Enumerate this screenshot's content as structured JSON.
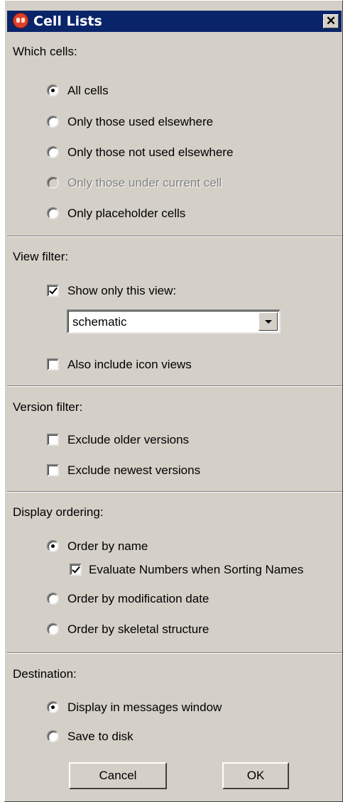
{
  "window": {
    "title": "Cell Lists"
  },
  "which_cells": {
    "label": "Which cells:",
    "options": [
      {
        "label": "All cells",
        "checked": true,
        "enabled": true
      },
      {
        "label": "Only those used elsewhere",
        "checked": false,
        "enabled": true
      },
      {
        "label": "Only those not used elsewhere",
        "checked": false,
        "enabled": true
      },
      {
        "label": "Only those under current cell",
        "checked": false,
        "enabled": false
      },
      {
        "label": "Only placeholder cells",
        "checked": false,
        "enabled": true
      }
    ]
  },
  "view_filter": {
    "label": "View filter:",
    "show_only_label": "Show only this view:",
    "show_only_checked": true,
    "view_select_value": "schematic",
    "include_icon_label": "Also include icon views",
    "include_icon_checked": false
  },
  "version_filter": {
    "label": "Version filter:",
    "exclude_older_label": "Exclude older versions",
    "exclude_older_checked": false,
    "exclude_newest_label": "Exclude newest versions",
    "exclude_newest_checked": false
  },
  "display_ordering": {
    "label": "Display ordering:",
    "order_name_label": "Order by name",
    "order_name_checked": true,
    "evaluate_numbers_label": "Evaluate Numbers when Sorting Names",
    "evaluate_numbers_checked": true,
    "order_date_label": "Order by modification date",
    "order_skeletal_label": "Order by skeletal structure"
  },
  "destination": {
    "label": "Destination:",
    "messages_label": "Display in messages window",
    "messages_checked": true,
    "disk_label": "Save to disk"
  },
  "buttons": {
    "cancel": "Cancel",
    "ok": "OK"
  },
  "icons": {
    "title": "app-icon",
    "close": "close-icon"
  }
}
